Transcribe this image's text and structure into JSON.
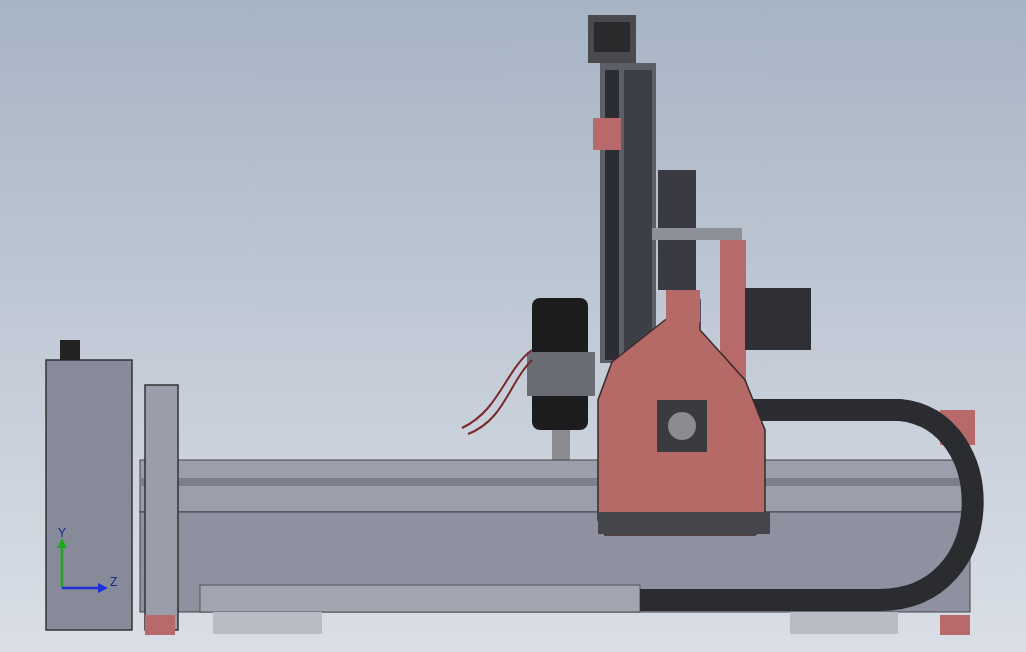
{
  "viewport": {
    "triad": {
      "axes": [
        {
          "kind": "vertical",
          "label": "Y",
          "color": "#1fa81f"
        },
        {
          "kind": "horizontal",
          "label": "Z",
          "color": "#1c2fd6"
        }
      ]
    }
  }
}
